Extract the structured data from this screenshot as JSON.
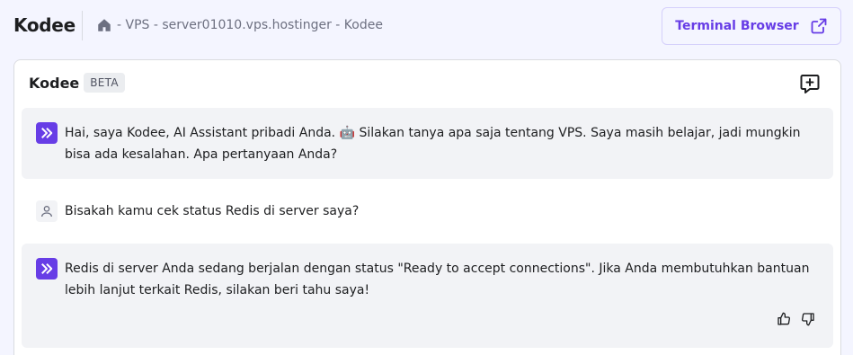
{
  "header": {
    "title": "Kodee",
    "breadcrumb": "- VPS - server01010.vps.hostinger - Kodee",
    "terminal_button": "Terminal Browser"
  },
  "chat": {
    "title": "Kodee",
    "badge": "BETA",
    "messages": [
      {
        "role": "assistant",
        "text": "Hai, saya Kodee, AI Assistant pribadi Anda. 🤖 Silakan tanya apa saja tentang VPS. Saya masih belajar, jadi mungkin bisa ada kesalahan. Apa pertanyaan Anda?"
      },
      {
        "role": "user",
        "text": "Bisakah kamu cek status Redis di server saya?"
      },
      {
        "role": "assistant",
        "text": "Redis di server Anda sedang berjalan dengan status \"Ready to accept connections\". Jika Anda membutuhkan bantuan lebih lanjut terkait Redis, silakan beri tahu saya!"
      }
    ]
  },
  "colors": {
    "accent": "#673de6",
    "page_bg": "#f4f5ff",
    "message_bg": "#f2f3f6"
  },
  "icons": [
    "home-icon",
    "external-link-icon",
    "new-chat-icon",
    "kodee-logo-icon",
    "user-icon",
    "thumbs-up-icon",
    "thumbs-down-icon"
  ]
}
